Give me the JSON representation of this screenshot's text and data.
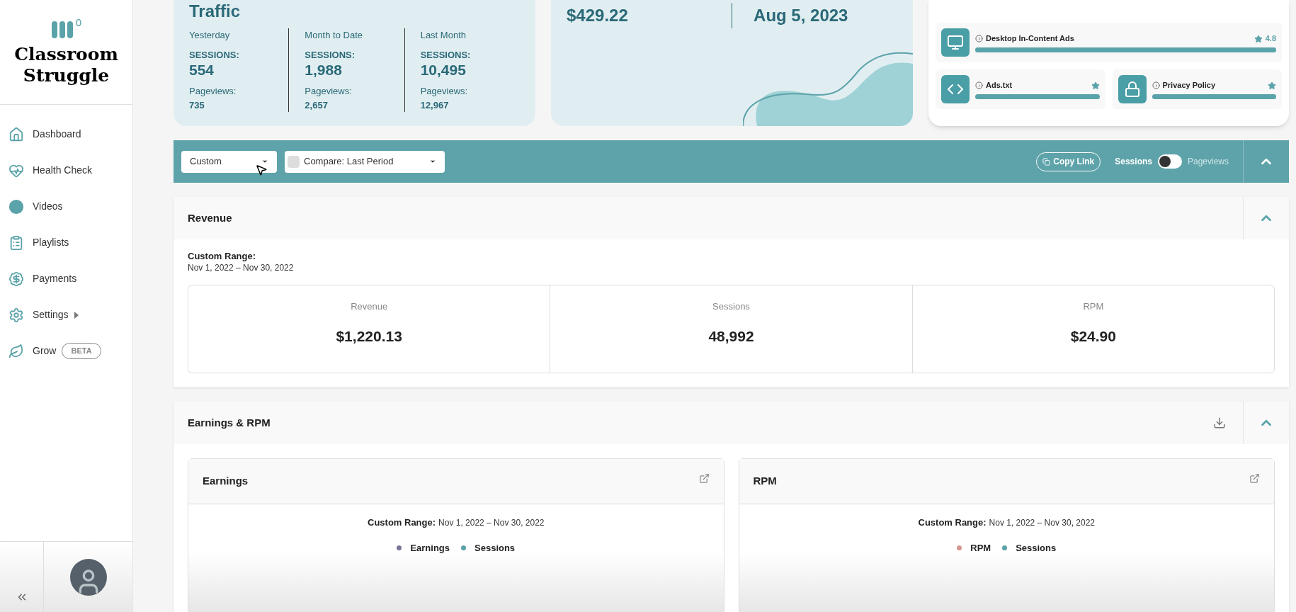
{
  "brand": {
    "name": "Classroom Struggle"
  },
  "sidebar": {
    "items": [
      {
        "label": "Dashboard"
      },
      {
        "label": "Health Check"
      },
      {
        "label": "Videos"
      },
      {
        "label": "Playlists"
      },
      {
        "label": "Payments"
      },
      {
        "label": "Settings",
        "has_submenu": true
      },
      {
        "label": "Grow",
        "badge": "BETA"
      }
    ]
  },
  "traffic": {
    "title": "Traffic",
    "columns": [
      {
        "period": "Yesterday",
        "sessions_label": "SESSIONS:",
        "sessions": "554",
        "pageviews_label": "Pageviews:",
        "pageviews": "735"
      },
      {
        "period": "Month to Date",
        "sessions_label": "SESSIONS:",
        "sessions": "1,988",
        "pageviews_label": "Pageviews:",
        "pageviews": "2,657"
      },
      {
        "period": "Last Month",
        "sessions_label": "SESSIONS:",
        "sessions": "10,495",
        "pageviews_label": "Pageviews:",
        "pageviews": "12,967"
      }
    ]
  },
  "earnings_card": {
    "values": [
      "$429.22",
      "Aug 5, 2023"
    ]
  },
  "health": {
    "items": [
      {
        "kind": "wide",
        "label": "Desktop In-Content Ads",
        "score": "4.8",
        "level": 1
      },
      {
        "kind": "half",
        "label": "Ads.txt",
        "level": 1
      },
      {
        "kind": "half",
        "label": "Privacy Policy",
        "level": 1
      }
    ]
  },
  "toolbar": {
    "range": "Custom",
    "compare": {
      "label": "Compare: Last Period",
      "checked": false
    },
    "copy_link": "Copy Link",
    "toggle": {
      "left": "Sessions",
      "right": "Pageviews",
      "on": false
    }
  },
  "revenue": {
    "title": "Revenue",
    "range_label": "Custom Range:",
    "range": "Nov 1, 2022 – Nov 30, 2022",
    "stats": [
      {
        "label": "Revenue",
        "value": "$1,220.13"
      },
      {
        "label": "Sessions",
        "value": "48,992"
      },
      {
        "label": "RPM",
        "value": "$24.90"
      }
    ]
  },
  "earnings_rpm": {
    "title": "Earnings & RPM",
    "charts": [
      {
        "title": "Earnings",
        "range_label": "Custom Range:",
        "range": "Nov 1, 2022 – Nov 30, 2022",
        "legend": [
          {
            "name": "Earnings",
            "color": "#7d7398"
          },
          {
            "name": "Sessions",
            "color": "#5ba3aa"
          }
        ]
      },
      {
        "title": "RPM",
        "range_label": "Custom Range:",
        "range": "Nov 1, 2022 – Nov 30, 2022",
        "legend": [
          {
            "name": "RPM",
            "color": "#d4968f"
          },
          {
            "name": "Sessions",
            "color": "#5ba3aa"
          }
        ]
      }
    ]
  }
}
